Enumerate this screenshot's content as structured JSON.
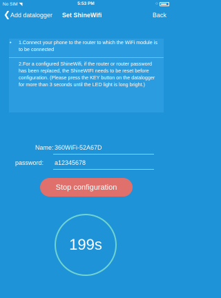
{
  "status_bar": {
    "carrier": "No SIM",
    "wifi_icon": "wifi-icon",
    "time": "5:53 PM",
    "battery_icon": "battery-icon"
  },
  "nav": {
    "back_icon": "chevron-left-icon",
    "previous_title": "Add datalogger",
    "title": "Set ShineWifi",
    "back_label": "Back"
  },
  "notes": {
    "bullet": "•",
    "step1": "1.Connect your phone to the router to which the WiFi module is to be connected",
    "step2": "2.For a configured ShineWifi, if the router or router password has been replaced, the ShineWIFI needs to be reset before configuration. (Please press the KEY button on the datalogger for more than 3 seconds until the LED light is long bright.)"
  },
  "form": {
    "name_label": "Name:",
    "name_value": "360WiFi-52A67D",
    "password_label": "password:",
    "password_value": "a12345678"
  },
  "stop_button_label": "Stop configuration",
  "countdown": "199s",
  "colors": {
    "background": "#1f93d8",
    "button": "#e0706c",
    "ring": "#6fd3cf"
  }
}
